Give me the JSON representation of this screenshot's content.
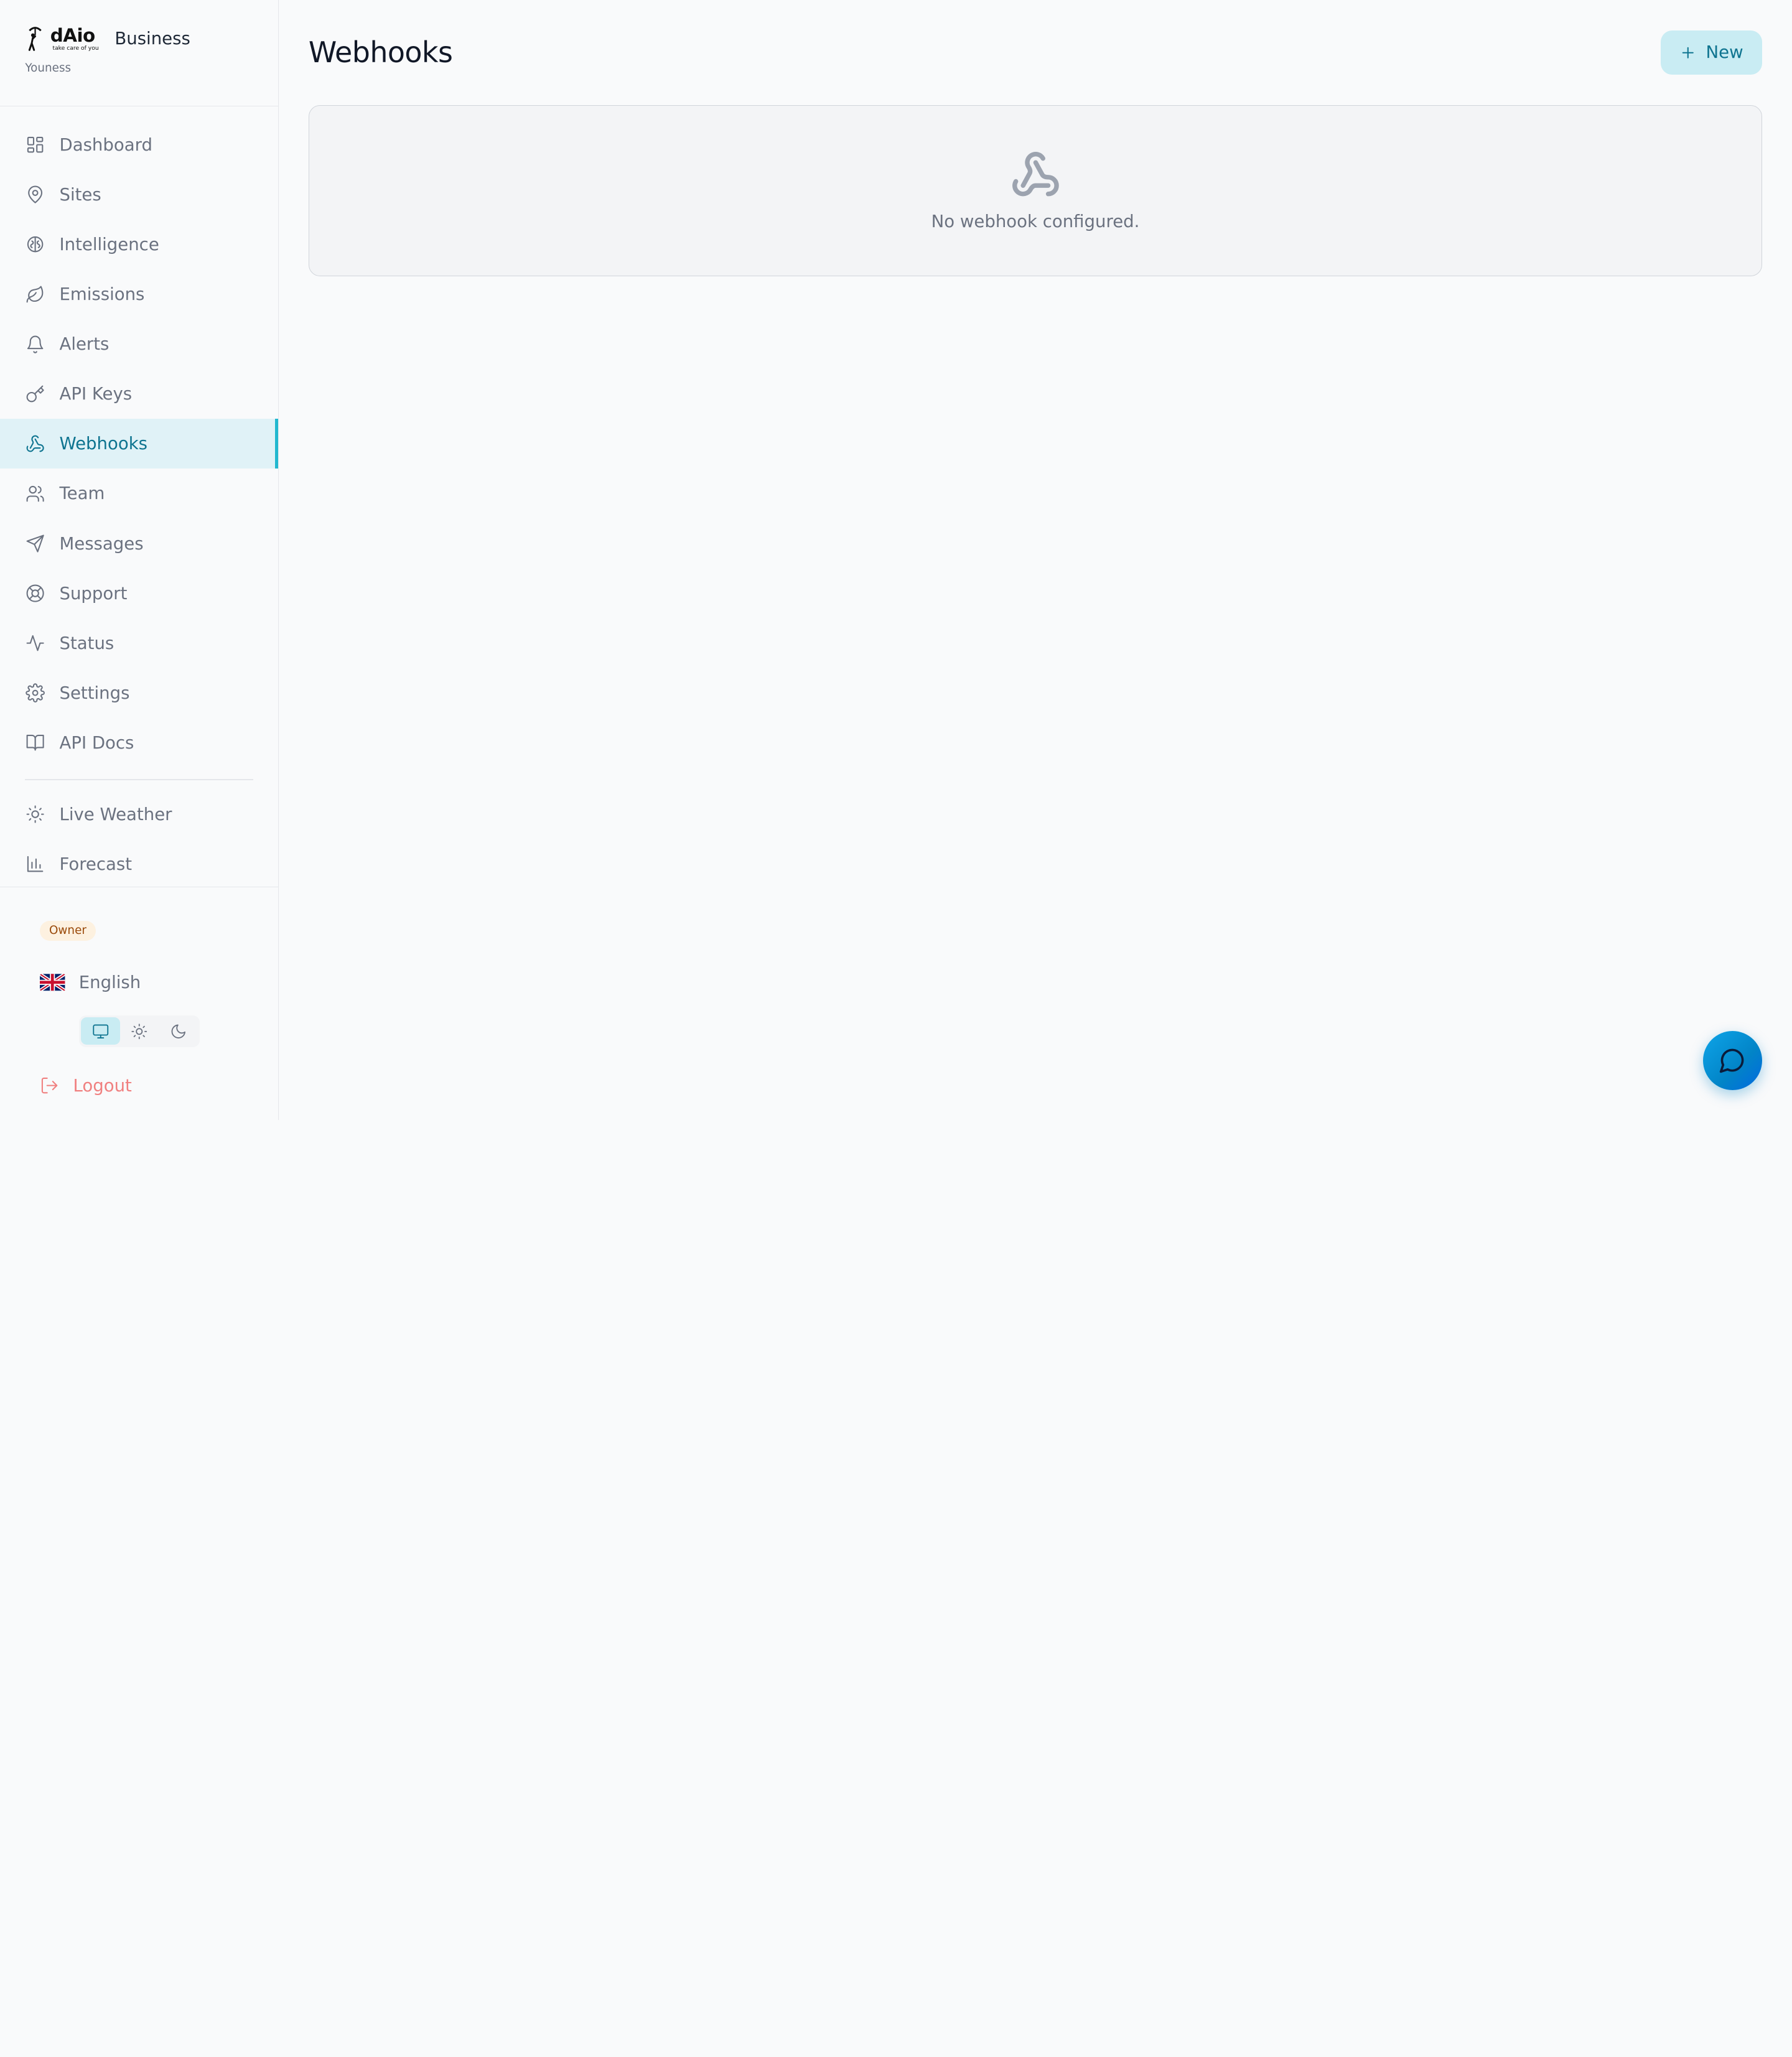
{
  "brand": {
    "logo_word": "dAio",
    "logo_tagline": "take care of you",
    "product": "Business",
    "user_name": "Youness"
  },
  "nav": {
    "items": [
      {
        "label": "Dashboard",
        "icon": "dashboard-icon"
      },
      {
        "label": "Sites",
        "icon": "map-pin-icon"
      },
      {
        "label": "Intelligence",
        "icon": "brain-icon"
      },
      {
        "label": "Emissions",
        "icon": "leaf-icon"
      },
      {
        "label": "Alerts",
        "icon": "bell-icon"
      },
      {
        "label": "API Keys",
        "icon": "key-icon"
      },
      {
        "label": "Webhooks",
        "icon": "webhook-icon",
        "active": true
      },
      {
        "label": "Team",
        "icon": "users-icon"
      },
      {
        "label": "Messages",
        "icon": "send-icon"
      },
      {
        "label": "Support",
        "icon": "life-buoy-icon"
      },
      {
        "label": "Status",
        "icon": "activity-icon"
      },
      {
        "label": "Settings",
        "icon": "gear-icon"
      },
      {
        "label": "API Docs",
        "icon": "book-open-icon"
      }
    ],
    "secondary": [
      {
        "label": "Live Weather",
        "icon": "sun-icon"
      },
      {
        "label": "Forecast",
        "icon": "bar-chart-icon"
      }
    ]
  },
  "footer": {
    "role": "Owner",
    "language": "English",
    "theme_options": [
      "system",
      "light",
      "dark"
    ],
    "theme_selected": "system",
    "logout": "Logout"
  },
  "main": {
    "title": "Webhooks",
    "new_button": "New",
    "empty_message": "No webhook configured."
  },
  "colors": {
    "accent": "#0e7490",
    "accent_bg": "#c9ecf3",
    "active_bar": "#22b8cf",
    "logout": "#f08080",
    "fab": "#0284c7"
  }
}
